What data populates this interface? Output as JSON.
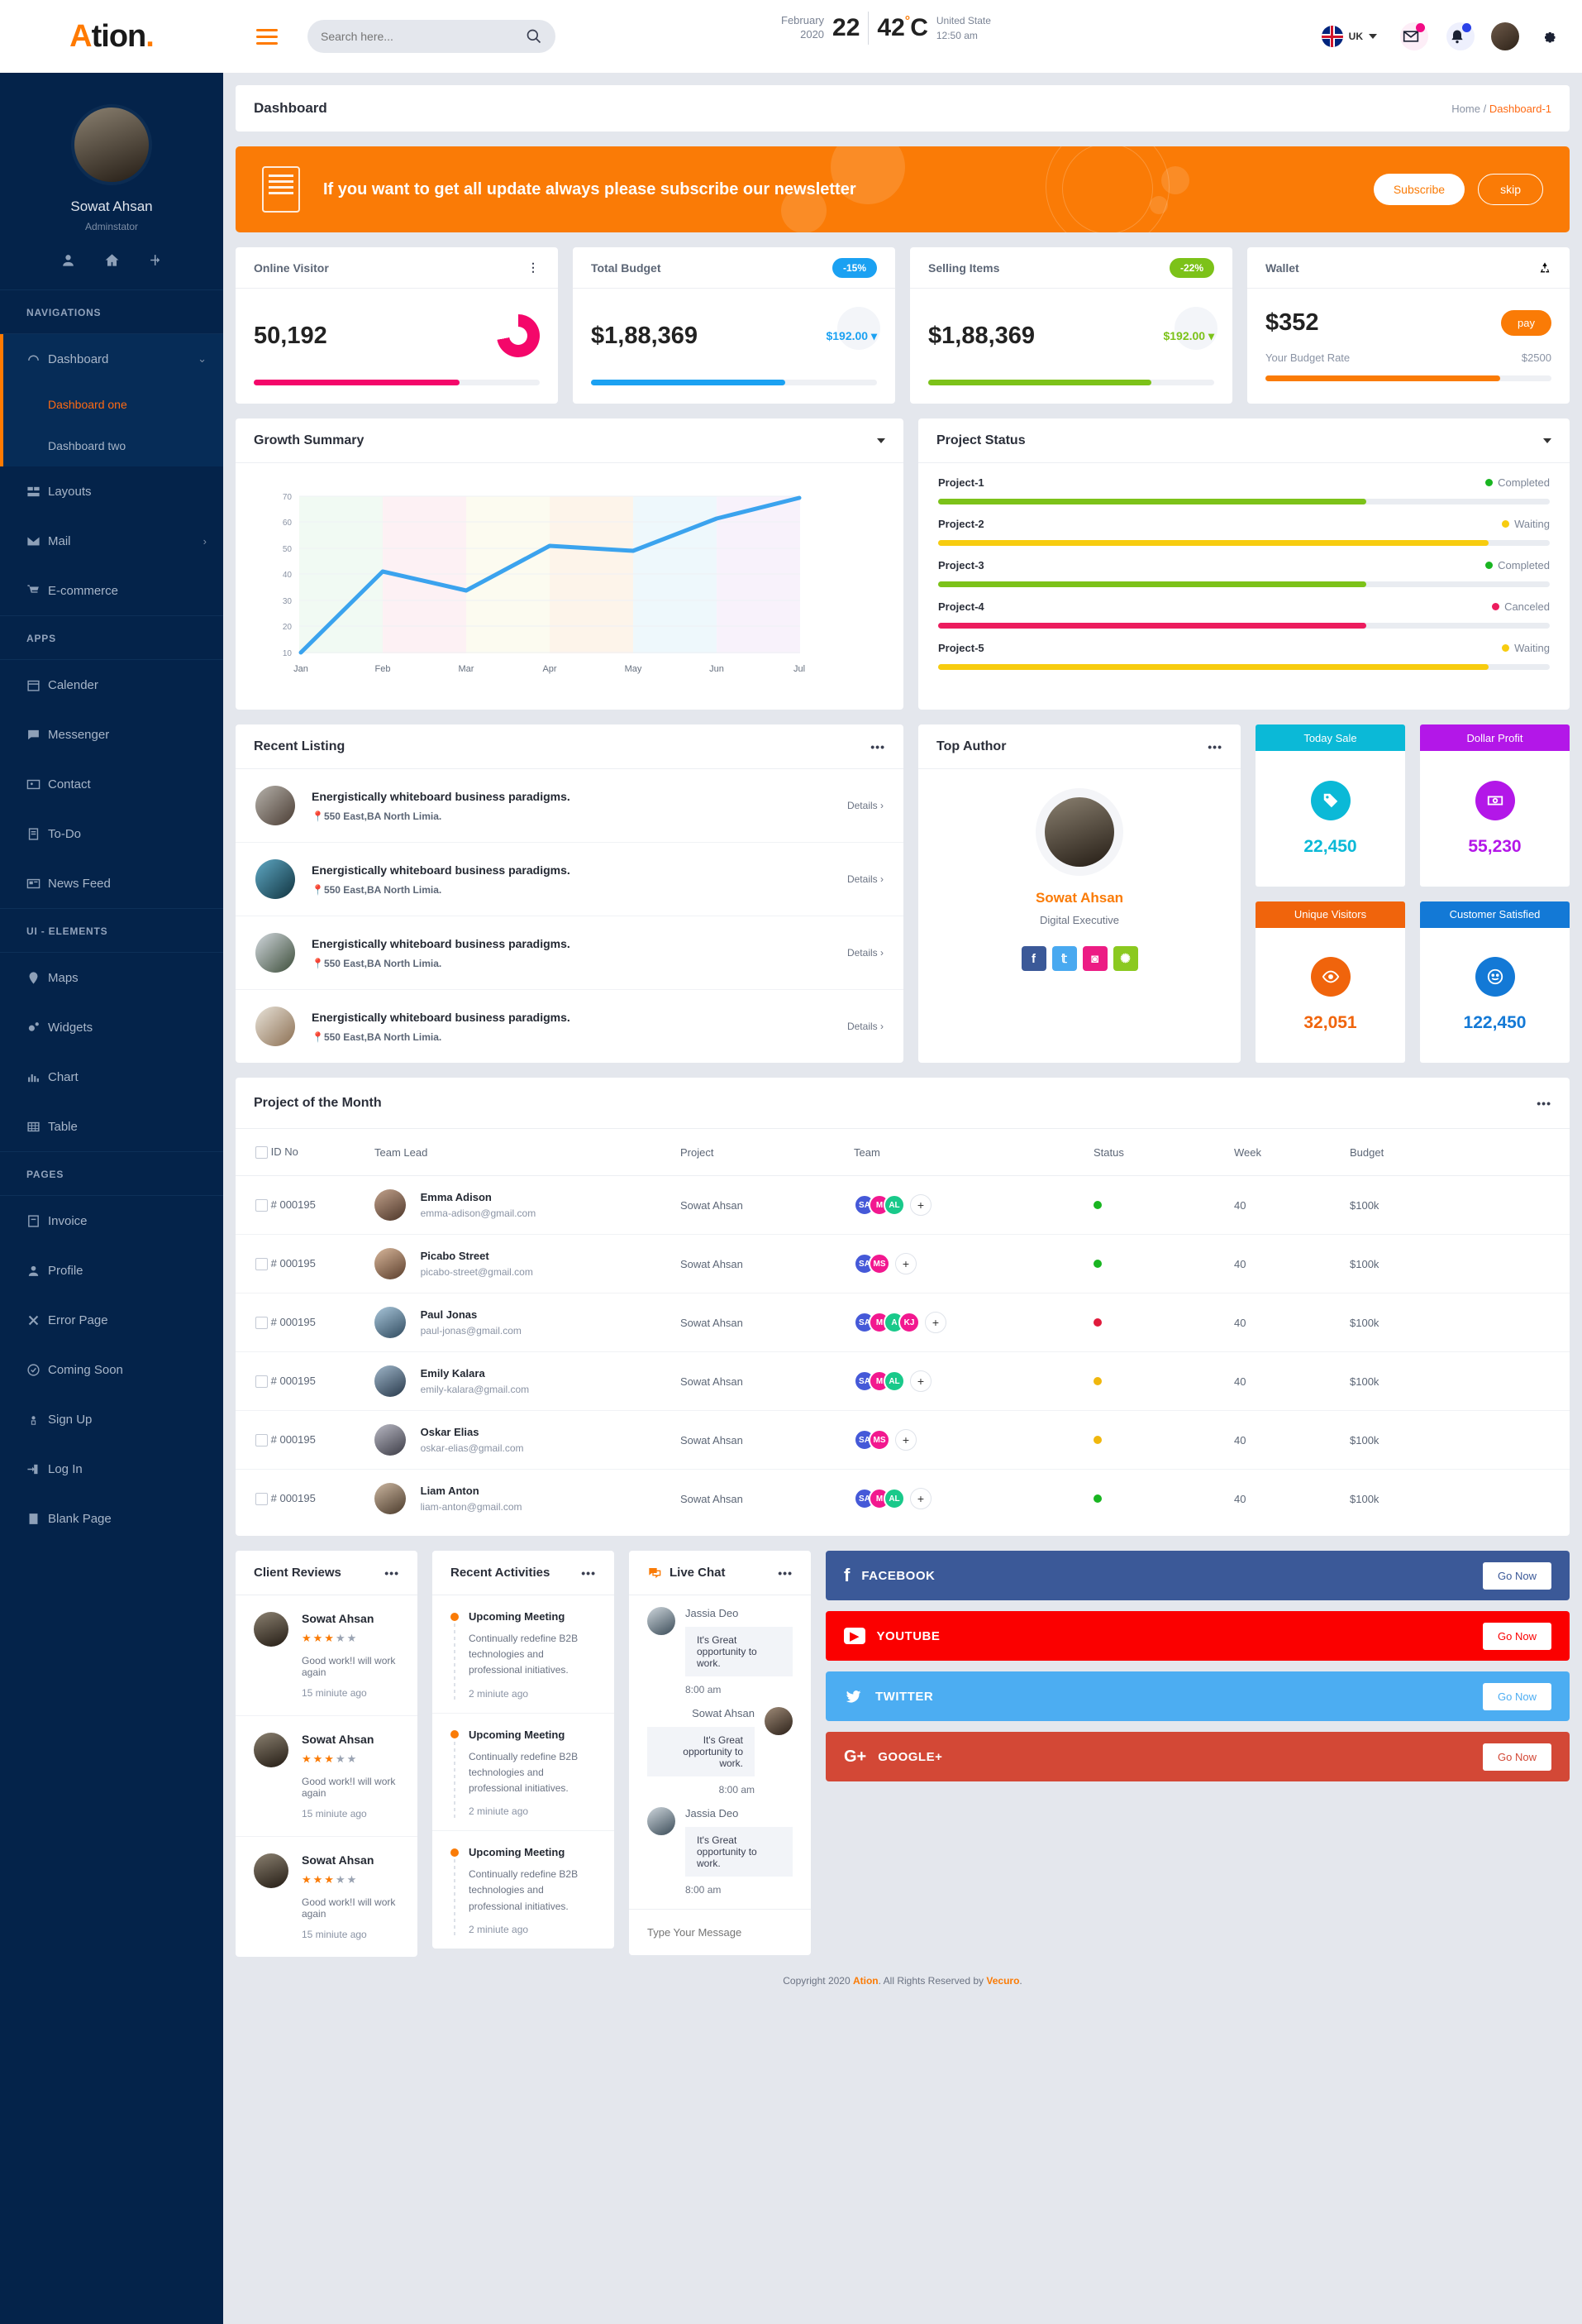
{
  "brand": {
    "mark": "A",
    "name": "tion",
    "dot": "."
  },
  "search": {
    "placeholder": "Search here...",
    "value": ""
  },
  "weather": {
    "month": "February",
    "year": "2020",
    "day": "22",
    "temp": "42",
    "deg": "°",
    "unit": "C",
    "country": "United State",
    "time": "12:50 am"
  },
  "header": {
    "language": "UK"
  },
  "sidebar": {
    "profile": {
      "name": "Sowat Ahsan",
      "role": "Adminstator"
    },
    "section_navigations": "NAVIGATIONS",
    "section_apps": "APPS",
    "section_ui": "UI - ELEMENTS",
    "section_pages": "PAGES",
    "nav": [
      {
        "label": "Dashboard",
        "icon": "speedometer-icon",
        "active": true
      },
      {
        "label": "Layouts",
        "icon": "layouts-icon"
      },
      {
        "label": "Mail",
        "icon": "mail-icon"
      },
      {
        "label": "E-commerce",
        "icon": "cart-icon"
      }
    ],
    "dashboard_sub": [
      {
        "label": "Dashboard one",
        "current": true
      },
      {
        "label": "Dashboard two",
        "current": false
      }
    ],
    "apps": [
      {
        "label": "Calender",
        "icon": "calendar-icon"
      },
      {
        "label": "Messenger",
        "icon": "message-icon"
      },
      {
        "label": "Contact",
        "icon": "contact-icon"
      },
      {
        "label": "To-Do",
        "icon": "todo-icon"
      },
      {
        "label": "News Feed",
        "icon": "news-icon"
      }
    ],
    "ui_elements": [
      {
        "label": "Maps",
        "icon": "map-pin-icon"
      },
      {
        "label": "Widgets",
        "icon": "widgets-icon"
      },
      {
        "label": "Chart",
        "icon": "chart-icon"
      },
      {
        "label": "Table",
        "icon": "table-icon"
      }
    ],
    "pages": [
      {
        "label": "Invoice",
        "icon": "invoice-icon"
      },
      {
        "label": "Profile",
        "icon": "profile-icon"
      },
      {
        "label": "Error Page",
        "icon": "close-icon"
      },
      {
        "label": "Coming Soon",
        "icon": "clock-check-icon"
      },
      {
        "label": "Sign Up",
        "icon": "signup-icon"
      },
      {
        "label": "Log In",
        "icon": "login-icon"
      },
      {
        "label": "Blank Page",
        "icon": "blank-page-icon"
      }
    ]
  },
  "page": {
    "title": "Dashboard",
    "crumb_home": "Home",
    "crumb_sep": "/",
    "crumb_current": "Dashboard-1"
  },
  "newsletter": {
    "text": "If you want to get all update always please subscribe our newsletter",
    "subscribe": "Subscribe",
    "skip": "skip",
    "bg": "#fa7b06"
  },
  "stats": [
    {
      "title": "Online Visitor",
      "value": "50,192",
      "badge": "",
      "badge_color": "",
      "sub": "",
      "sub_color": "",
      "accent": "#f4076a",
      "progress": 72,
      "kind": "donut"
    },
    {
      "title": "Total Budget",
      "value": "$1,88,369",
      "badge": "-15%",
      "badge_color": "#1ba1f2",
      "sub": "$192.00",
      "sub_color": "#1ba1f2",
      "accent": "#1ba1f2",
      "progress": 68,
      "kind": "plain"
    },
    {
      "title": "Selling Items",
      "value": "$1,88,369",
      "badge": "-22%",
      "badge_color": "#7cc219",
      "sub": "$192.00",
      "sub_color": "#7cc219",
      "accent": "#7cc219",
      "progress": 78,
      "kind": "plain"
    },
    {
      "title": "Wallet",
      "value": "$352",
      "badge": "",
      "badge_color": "",
      "sub": "",
      "sub_color": "",
      "accent": "#fa7b06",
      "progress": 82,
      "kind": "wallet",
      "pay": "pay",
      "rate_label": "Your Budget Rate",
      "rate_value": "$2500"
    }
  ],
  "growth": {
    "title": "Growth Summary"
  },
  "chart_data": {
    "type": "line",
    "title": "Growth Summary",
    "x": [
      "Jan",
      "Feb",
      "Mar",
      "Apr",
      "May",
      "Jun",
      "Jul"
    ],
    "values": [
      10,
      41,
      34.5,
      51,
      49,
      61.5,
      69
    ],
    "xlabel": "",
    "ylabel": "",
    "ylim": [
      10,
      70
    ],
    "yticks": [
      10,
      20,
      30,
      40,
      50,
      60,
      70
    ],
    "series_color": "#3ba3ee",
    "grid": true,
    "legend": "none",
    "band_colors": [
      "#f1faf3",
      "#fdf1f4",
      "#fcfbf0",
      "#fdf4ea",
      "#eef8fc",
      "#f8f2fb"
    ]
  },
  "project_status": {
    "title": "Project Status",
    "rows": [
      {
        "name": "Project-1",
        "status": "Completed",
        "color": "#7cc219",
        "progress": 70
      },
      {
        "name": "Project-2",
        "status": "Waiting",
        "color": "#f7cc0f",
        "progress": 90
      },
      {
        "name": "Project-3",
        "status": "Completed",
        "color": "#7cc219",
        "progress": 70
      },
      {
        "name": "Project-4",
        "status": "Canceled",
        "color": "#ec1c5e",
        "progress": 70
      },
      {
        "name": "Project-5",
        "status": "Waiting",
        "color": "#f7cc0f",
        "progress": 90
      }
    ]
  },
  "recent_listing": {
    "title": "Recent Listing",
    "items": [
      {
        "title": "Energistically whiteboard business paradigms.",
        "address": "550 East,BA North Limia.",
        "details": "Details",
        "thumb": "#6d5548"
      },
      {
        "title": "Energistically whiteboard business paradigms.",
        "address": "550 East,BA North Limia.",
        "details": "Details",
        "thumb": "#1f5d75"
      },
      {
        "title": "Energistically whiteboard business paradigms.",
        "address": "550 East,BA North Limia.",
        "details": "Details",
        "thumb": "#4e5a4a"
      },
      {
        "title": "Energistically whiteboard business paradigms.",
        "address": "550 East,BA North Limia.",
        "details": "Details",
        "thumb": "#9c8c77"
      }
    ]
  },
  "top_author": {
    "title": "Top Author",
    "name": "Sowat Ahsan",
    "role": "Digital Executive",
    "socials": [
      {
        "icon": "facebook-icon",
        "glyph": "f",
        "color": "#3b5998"
      },
      {
        "icon": "twitter-icon",
        "glyph": "t",
        "color": "#49a9f0"
      },
      {
        "icon": "instagram-icon",
        "glyph": "◙",
        "color": "#ec1c84"
      },
      {
        "icon": "dribbble-icon",
        "glyph": "✺",
        "color": "#8bc920"
      }
    ]
  },
  "mini_stats": [
    {
      "title": "Today Sale",
      "value": "22,450",
      "color": "#0bb9d7",
      "icon": "tag-icon"
    },
    {
      "title": "Dollar Profit",
      "value": "55,230",
      "color": "#b317e8",
      "icon": "money-icon"
    },
    {
      "title": "Unique Visitors",
      "value": "32,051",
      "color": "#f0640c",
      "icon": "eye-icon"
    },
    {
      "title": "Customer Satisfied",
      "value": "122,450",
      "color": "#1379d6",
      "icon": "smile-icon"
    }
  ],
  "project_table": {
    "title": "Project of the Month",
    "columns": [
      "ID No",
      "Team Lead",
      "Project",
      "Team",
      "Status",
      "Week",
      "Budget"
    ],
    "rows": [
      {
        "id": "# 000195",
        "lead": "Emma Adison",
        "email": "emma-adison@gmail.com",
        "project": "Sowat Ahsan",
        "team": [
          "SA",
          "M",
          "AL"
        ],
        "status_color": "#19b521",
        "week": "40",
        "budget": "$100k",
        "av": "#7a5b4a"
      },
      {
        "id": "# 000195",
        "lead": "Picabo Street",
        "email": "picabo-street@gmail.com",
        "project": "Sowat Ahsan",
        "team": [
          "SA",
          "MS"
        ],
        "status_color": "#19b521",
        "week": "40",
        "budget": "$100k",
        "av": "#8a6b52"
      },
      {
        "id": "# 000195",
        "lead": "Paul Jonas",
        "email": "paul-jonas@gmail.com",
        "project": "Sowat Ahsan",
        "team": [
          "SA",
          "M",
          "A",
          "KJ"
        ],
        "status_color": "#e01b3c",
        "week": "40",
        "budget": "$100k",
        "av": "#4d6b86"
      },
      {
        "id": "# 000195",
        "lead": "Emily Kalara",
        "email": "emily-kalara@gmail.com",
        "project": "Sowat Ahsan",
        "team": [
          "SA",
          "M",
          "AL"
        ],
        "status_color": "#f0b70d",
        "week": "40",
        "budget": "$100k",
        "av": "#3f5a73"
      },
      {
        "id": "# 000195",
        "lead": "Oskar Elias",
        "email": "oskar-elias@gmail.com",
        "project": "Sowat Ahsan",
        "team": [
          "SA",
          "MS"
        ],
        "status_color": "#f0b70d",
        "week": "40",
        "budget": "$100k",
        "av": "#5c5c66"
      },
      {
        "id": "# 000195",
        "lead": "Liam Anton",
        "email": "liam-anton@gmail.com",
        "project": "Sowat Ahsan",
        "team": [
          "SA",
          "M",
          "AL"
        ],
        "status_color": "#19b521",
        "week": "40",
        "budget": "$100k",
        "av": "#7e6b5a"
      }
    ],
    "team_colors": [
      "#4559d8",
      "#f2188f",
      "#19c98a",
      "#f2188f"
    ],
    "add_glyph": "+"
  },
  "client_reviews": {
    "title": "Client Reviews",
    "items": [
      {
        "name": "Sowat Ahsan",
        "rating": 3,
        "text": "Good work!I will work again",
        "time": "15 miniute ago"
      },
      {
        "name": "Sowat Ahsan",
        "rating": 3,
        "text": "Good work!I will work again",
        "time": "15 miniute ago"
      },
      {
        "name": "Sowat Ahsan",
        "rating": 3,
        "text": "Good work!I will work again",
        "time": "15 miniute ago"
      }
    ],
    "star_on": "#fa7b06",
    "star_off": "#9aa3b2"
  },
  "recent_activities": {
    "title": "Recent Activities",
    "items": [
      {
        "title": "Upcoming Meeting",
        "desc": "Continually redefine B2B technologies and professional initiatives.",
        "time": "2 miniute ago"
      },
      {
        "title": "Upcoming Meeting",
        "desc": "Continually redefine B2B technologies and professional initiatives.",
        "time": "2 miniute ago"
      },
      {
        "title": "Upcoming Meeting",
        "desc": "Continually redefine B2B technologies and professional initiatives.",
        "time": "2 miniute ago"
      }
    ]
  },
  "live_chat": {
    "title": "Live Chat",
    "messages": [
      {
        "name": "Jassia Deo",
        "text": "It's Great opportunity to work.",
        "time": "8:00 am",
        "side": "left",
        "av": "#6b7d8c"
      },
      {
        "name": "Sowat Ahsan",
        "text": "It's Great opportunity to work.",
        "time": "8:00 am",
        "side": "right",
        "av": "#6e5a4a"
      },
      {
        "name": "Jassia Deo",
        "text": "It's Great opportunity to work.",
        "time": "8:00 am",
        "side": "left",
        "av": "#6b7d8c"
      }
    ],
    "placeholder": "Type Your Message"
  },
  "social_bars": [
    {
      "label": "FACEBOOK",
      "btn": "Go Now",
      "bg": "#3b5998",
      "icon": "facebook-icon",
      "glyph": "f"
    },
    {
      "label": "YOUTUBE",
      "btn": "Go Now",
      "bg": "#fb0000",
      "icon": "youtube-icon",
      "glyph": "▶"
    },
    {
      "label": "TWITTER",
      "btn": "Go Now",
      "bg": "#4cadf2",
      "icon": "twitter-icon",
      "glyph": "🐦"
    },
    {
      "label": "GOOGLE+",
      "btn": "Go Now",
      "bg": "#d34836",
      "icon": "googleplus-icon",
      "glyph": "G+"
    }
  ],
  "footer": {
    "pre": "Copyright 2020 ",
    "brand": "Ation",
    "mid": ". All Rights Reserved by ",
    "by": "Vecuro",
    "post": "."
  }
}
